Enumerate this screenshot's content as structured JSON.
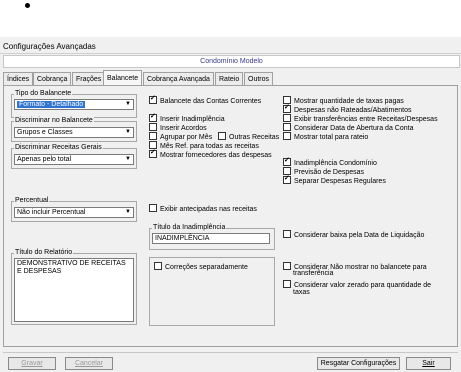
{
  "window": {
    "title": "Configurações Avançadas",
    "header": "Condomínio Modelo"
  },
  "tabs": [
    "Índices",
    "Cobrança",
    "Frações",
    "Balancete",
    "Cobrança Avançada",
    "Rateio",
    "Outros"
  ],
  "active_tab": "Balancete",
  "left": {
    "tipo": {
      "label": "Tipo do Balancete",
      "value": "Formato - Detalhado"
    },
    "discriminar_balancete": {
      "label": "Discriminar no Balancete",
      "value": "Grupos e Classes"
    },
    "discriminar_receitas": {
      "label": "Discriminar Receitas Gerais",
      "value": "Apenas pelo total"
    },
    "percentual": {
      "label": "Percentual",
      "value": "Não incluir Percentual"
    },
    "titulo_relatorio": {
      "label": "Título do Relatório",
      "value": "DEMONSTRATIVO DE RECEITAS E DESPESAS"
    }
  },
  "middle": {
    "balancete_contas": {
      "label": "Balancete das Contas Correntes",
      "checked": true
    },
    "inserir_inadimplencia": {
      "label": "Inserir Inadimplência",
      "checked": true
    },
    "inserir_acordos": {
      "label": "Inserir Acordos",
      "checked": false
    },
    "agrupar_mes": {
      "label": "Agrupar por Mês",
      "checked": false
    },
    "outras_receitas": {
      "label": "Outras Receitas",
      "checked": false
    },
    "mes_ref": {
      "label": "Mês Ref. para todas as receitas",
      "checked": false
    },
    "mostrar_fornecedores": {
      "label": "Mostrar fornecedores das despesas",
      "checked": true
    },
    "exibir_antecipadas": {
      "label": "Exibir antecipadas nas receitas",
      "checked": false
    },
    "titulo_inadimplencia": {
      "label": "Título da Inadimplência",
      "value": "INADIMPLÊNCIA"
    },
    "correcoes": {
      "label": "Correções separadamente",
      "checked": false
    }
  },
  "right": {
    "mostrar_qtd_taxas": {
      "label": "Mostrar quantidade de taxas pagas",
      "checked": false
    },
    "despesas_nao_rateadas": {
      "label": "Despesas não Rateadas/Abatimentos",
      "checked": true
    },
    "exibir_transferencias": {
      "label": "Exibir transferências entre Receitas/Despesas",
      "checked": false
    },
    "considerar_data": {
      "label": "Considerar Data de Abertura da Conta",
      "checked": false
    },
    "mostrar_total_rateio": {
      "label": "Mostrar total para rateio",
      "checked": false
    },
    "inadimplencia_condominio": {
      "label": "Inadimplência Condomínio",
      "checked": true
    },
    "previsao_despesas": {
      "label": "Previsão de Despesas",
      "checked": false
    },
    "separar_despesas": {
      "label": "Separar Despesas Regulares",
      "checked": true
    },
    "considerar_baixa": {
      "label": "Considerar baixa pela Data de Liquidação",
      "checked": false
    },
    "considerar_nao_mostrar": {
      "label1": "Considerar Não mostrar no balancete para",
      "label2": "transferência",
      "checked": false
    },
    "considerar_valor_zerado": {
      "label1": "Considerar valor zerado para quantidade de",
      "label2": "taxas",
      "checked": false
    }
  },
  "buttons": {
    "gravar": {
      "label": "Gravar",
      "enabled": false
    },
    "cancelar": {
      "label": "Cancelar",
      "enabled": false
    },
    "resgatar": {
      "label": "Resgatar Configurações",
      "enabled": true
    },
    "sair": {
      "label": "Sair",
      "enabled": true
    }
  }
}
